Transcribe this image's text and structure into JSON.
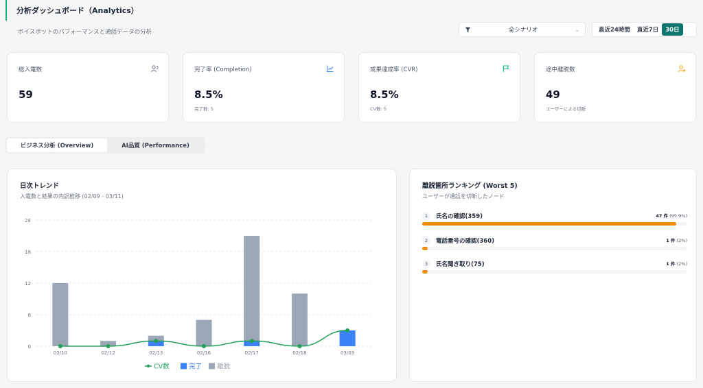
{
  "header": {
    "title": "分析ダッシュボード（Analytics）",
    "subtitle": "ボイスボットのパフォーマンスと通話データの分析"
  },
  "filter": {
    "value": "全シナリオ"
  },
  "range": {
    "options": [
      "直近24時間",
      "直近7日",
      "30日"
    ],
    "active": "30日"
  },
  "kpis": [
    {
      "label": "総入電数",
      "value": "59",
      "sub": "",
      "icon": "users-icon",
      "color": "#6b7280"
    },
    {
      "label": "完了率 (Completion)",
      "value": "8.5%",
      "sub": "完了数: 5",
      "icon": "chart-line-icon",
      "color": "#3b82f6"
    },
    {
      "label": "成果達成率 (CVR)",
      "value": "8.5%",
      "sub": "CV数: 5",
      "icon": "flag-icon",
      "color": "#10b981"
    },
    {
      "label": "途中離脱数",
      "value": "49",
      "sub": "ユーザーによる切断",
      "icon": "user-x-icon",
      "color": "#f59e0b"
    }
  ],
  "tabs": [
    {
      "label": "ビジネス分析 (Overview)",
      "active": true
    },
    {
      "label": "AI品質 (Performance)",
      "active": false
    }
  ],
  "trend": {
    "title": "日次トレンド",
    "subtitle": "入電数と結果の内訳推移 (02/09 - 03/11)"
  },
  "chart_data": {
    "type": "bar",
    "categories": [
      "02/10",
      "02/12",
      "02/13",
      "02/16",
      "02/17",
      "02/18",
      "03/03"
    ],
    "series": [
      {
        "name": "CV数",
        "kind": "line",
        "color": "#22a05a",
        "values": [
          0,
          0,
          1,
          0,
          1,
          0,
          3
        ]
      },
      {
        "name": "完了",
        "kind": "bar",
        "color": "#3b82f6",
        "values": [
          0,
          0,
          1,
          0,
          1,
          0,
          3
        ]
      },
      {
        "name": "離脱",
        "kind": "bar",
        "color": "#9ba6b6",
        "values": [
          12,
          1,
          1,
          5,
          20,
          10,
          0
        ]
      }
    ],
    "stacked": true,
    "yticks": [
      0,
      6,
      12,
      18,
      24
    ],
    "ylim": [
      0,
      24
    ],
    "grid": true,
    "legend": "bottom"
  },
  "ranking": {
    "title": "離脱箇所ランキング (Worst 5)",
    "subtitle": "ユーザーが通話を切断したノード",
    "items": [
      {
        "rank": "1",
        "label": "氏名の確認(359)",
        "count": "47 件",
        "pct": "(95.9%)",
        "fraction": 0.959
      },
      {
        "rank": "2",
        "label": "電話番号の確認(360)",
        "count": "1 件",
        "pct": "(2%)",
        "fraction": 0.02
      },
      {
        "rank": "3",
        "label": "氏名聞き取り(75)",
        "count": "1 件",
        "pct": "(2%)",
        "fraction": 0.02
      }
    ]
  }
}
